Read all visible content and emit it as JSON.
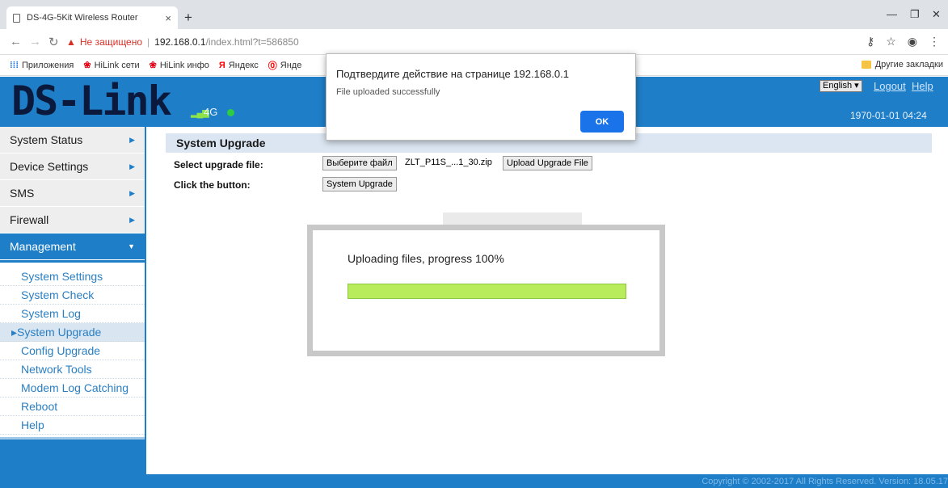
{
  "browser": {
    "tab_title": "DS-4G-5Kit Wireless Router",
    "tab_close": "×",
    "new_tab": "+",
    "window_min": "—",
    "window_max": "❐",
    "window_close": "✕",
    "insecure_label": "Не защищено",
    "url_host": "192.168.0.1",
    "url_path": "/index.html?t=586850",
    "bookmarks": [
      {
        "icon": "apps-icon",
        "label": "Приложения"
      },
      {
        "icon": "huawei-icon",
        "label": "HiLink сети"
      },
      {
        "icon": "huawei-icon",
        "label": "HiLink инфо"
      },
      {
        "icon": "yandex-icon",
        "label": "Яндекс"
      },
      {
        "icon": "yandex-box-icon",
        "label": "Янде"
      }
    ],
    "other_bookmarks": "Другие закладки"
  },
  "header": {
    "logo": "DS-Link",
    "network": "4G",
    "language": "English",
    "logout": "Logout",
    "help": "Help",
    "datetime": "1970-01-01 04:24"
  },
  "sidebar": {
    "menu": [
      {
        "label": "System Status"
      },
      {
        "label": "Device Settings"
      },
      {
        "label": "SMS"
      },
      {
        "label": "Firewall"
      },
      {
        "label": "Management"
      }
    ],
    "submenu": [
      {
        "label": "System Settings"
      },
      {
        "label": "System Check"
      },
      {
        "label": "System Log"
      },
      {
        "label": "System Upgrade"
      },
      {
        "label": "Config Upgrade"
      },
      {
        "label": "Network Tools"
      },
      {
        "label": "Modem Log Catching"
      },
      {
        "label": "Reboot"
      },
      {
        "label": "Help"
      }
    ]
  },
  "main": {
    "section_title": "System Upgrade",
    "select_label": "Select upgrade file:",
    "choose_file": "Выберите файл",
    "file_name": "ZLT_P11S_...1_30.zip",
    "upload_button": "Upload Upgrade File",
    "click_label": "Click the button:",
    "upgrade_button": "System Upgrade"
  },
  "progress": {
    "text": "Uploading files, progress 100%",
    "percent": 100
  },
  "alert": {
    "title": "Подтвердите действие на странице 192.168.0.1",
    "message": "File uploaded successfully",
    "ok": "OK"
  },
  "footer": {
    "copyright": "Copyright © 2002-2017 All Rights Reserved. Version: 18.05.17"
  },
  "colors": {
    "brand_blue": "#1e7ec7",
    "progress_green": "#b8ec5c",
    "alert_button": "#1a73e8"
  }
}
